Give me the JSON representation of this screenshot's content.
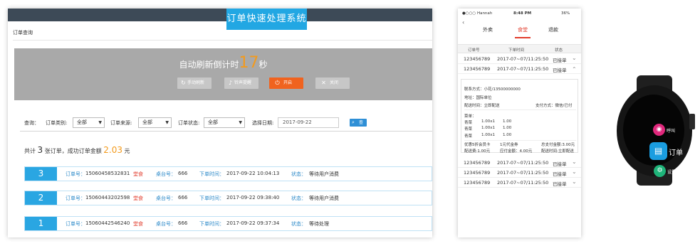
{
  "desktop": {
    "title": "订单快速处理系统",
    "breadcrumb": "订单查询",
    "refresh": {
      "prefix": "自动刷新倒计时",
      "seconds": "17",
      "suffix": "秒",
      "buttons": {
        "manual": "手动刷新",
        "sound": "铃声提醒",
        "start": "开启",
        "close": "关闭"
      }
    },
    "filters": {
      "query_label": "查询：",
      "type_label": "订单类别:",
      "type_value": "全部",
      "source_label": "订单来源:",
      "source_value": "全部",
      "status_label": "订单状态:",
      "status_value": "全部",
      "date_label": "选择日期:",
      "date_value": "2017-09-22",
      "search_button": "查询"
    },
    "summary": {
      "prefix": "共计",
      "count": "3",
      "middle": "张订单，成功订单金额",
      "amount": "2.03",
      "unit": "元"
    },
    "order_labels": {
      "order_no": "订单号：",
      "table_no": "桌台号：",
      "time": "下单时间：",
      "status": "状态："
    },
    "orders": [
      {
        "index": "3",
        "order_no": "15060458532831",
        "tag": "堂食",
        "table": "666",
        "time": "2017-09-22 10:04:13",
        "status": "等待用户消费"
      },
      {
        "index": "2",
        "order_no": "15060443202598",
        "tag": "堂食",
        "table": "666",
        "time": "2017-09-22 09:38:40",
        "status": "等待用户消费"
      },
      {
        "index": "1",
        "order_no": "15060442546240",
        "tag": "堂食",
        "table": "666",
        "time": "2017-09-22 09:37:34",
        "status": "等待处理"
      }
    ]
  },
  "phone": {
    "status_bar": {
      "carrier": "●○○○ Hannah",
      "time": "8:48 PM",
      "battery": "36%"
    },
    "tabs": [
      "外卖",
      "食堂",
      "退款"
    ],
    "active_tab": "食堂",
    "columns": [
      "订单号",
      "下单时间",
      "状态"
    ],
    "rows": [
      {
        "no": "123456789",
        "time": "2017-07~07/11:25:50",
        "status": "已接单"
      },
      {
        "no": "123456789",
        "time": "2017-07~07/11:25:50",
        "status": "已接单"
      },
      {
        "no": "123456789",
        "time": "2017-07~07/11:25:50",
        "status": "已接单"
      },
      {
        "no": "123456789",
        "time": "2017-07~07/11:25:50",
        "status": "已接单"
      },
      {
        "no": "123456789",
        "time": "2017-07~07/11:25:50",
        "status": "已接单"
      },
      {
        "no": "123456789",
        "time": "2017-07~07/11:25:50",
        "status": "已接单"
      },
      {
        "no": "123456789",
        "time": "2017-07~07/11:25:50",
        "status": "已接单"
      }
    ],
    "detail": {
      "contact": "联系方式：小花/13500000000",
      "address": "地址：国际单位",
      "delivery_time": "配送时间：立即配送",
      "payment": "支付方式：微信/已付",
      "menu_label": "菜单：",
      "items": [
        {
          "name": "青菜",
          "qty": "1.00x1",
          "price": "1.00"
        },
        {
          "name": "青菜",
          "qty": "1.00x1",
          "price": "1.00"
        },
        {
          "name": "青菜",
          "qty": "1.00x1",
          "price": "1.00"
        }
      ],
      "promo": "优惠5折会员卡",
      "coupon": "1元代金券",
      "total_due": "总支付金额:3.00元",
      "delivery_fee": "配送费:1.00元",
      "paid": "应付金额：4.00元",
      "delivery_note": "配送时间:立即配送"
    }
  },
  "watch": {
    "call_label": "呼叫",
    "order_label": "订单",
    "settings_label": "设置"
  }
}
